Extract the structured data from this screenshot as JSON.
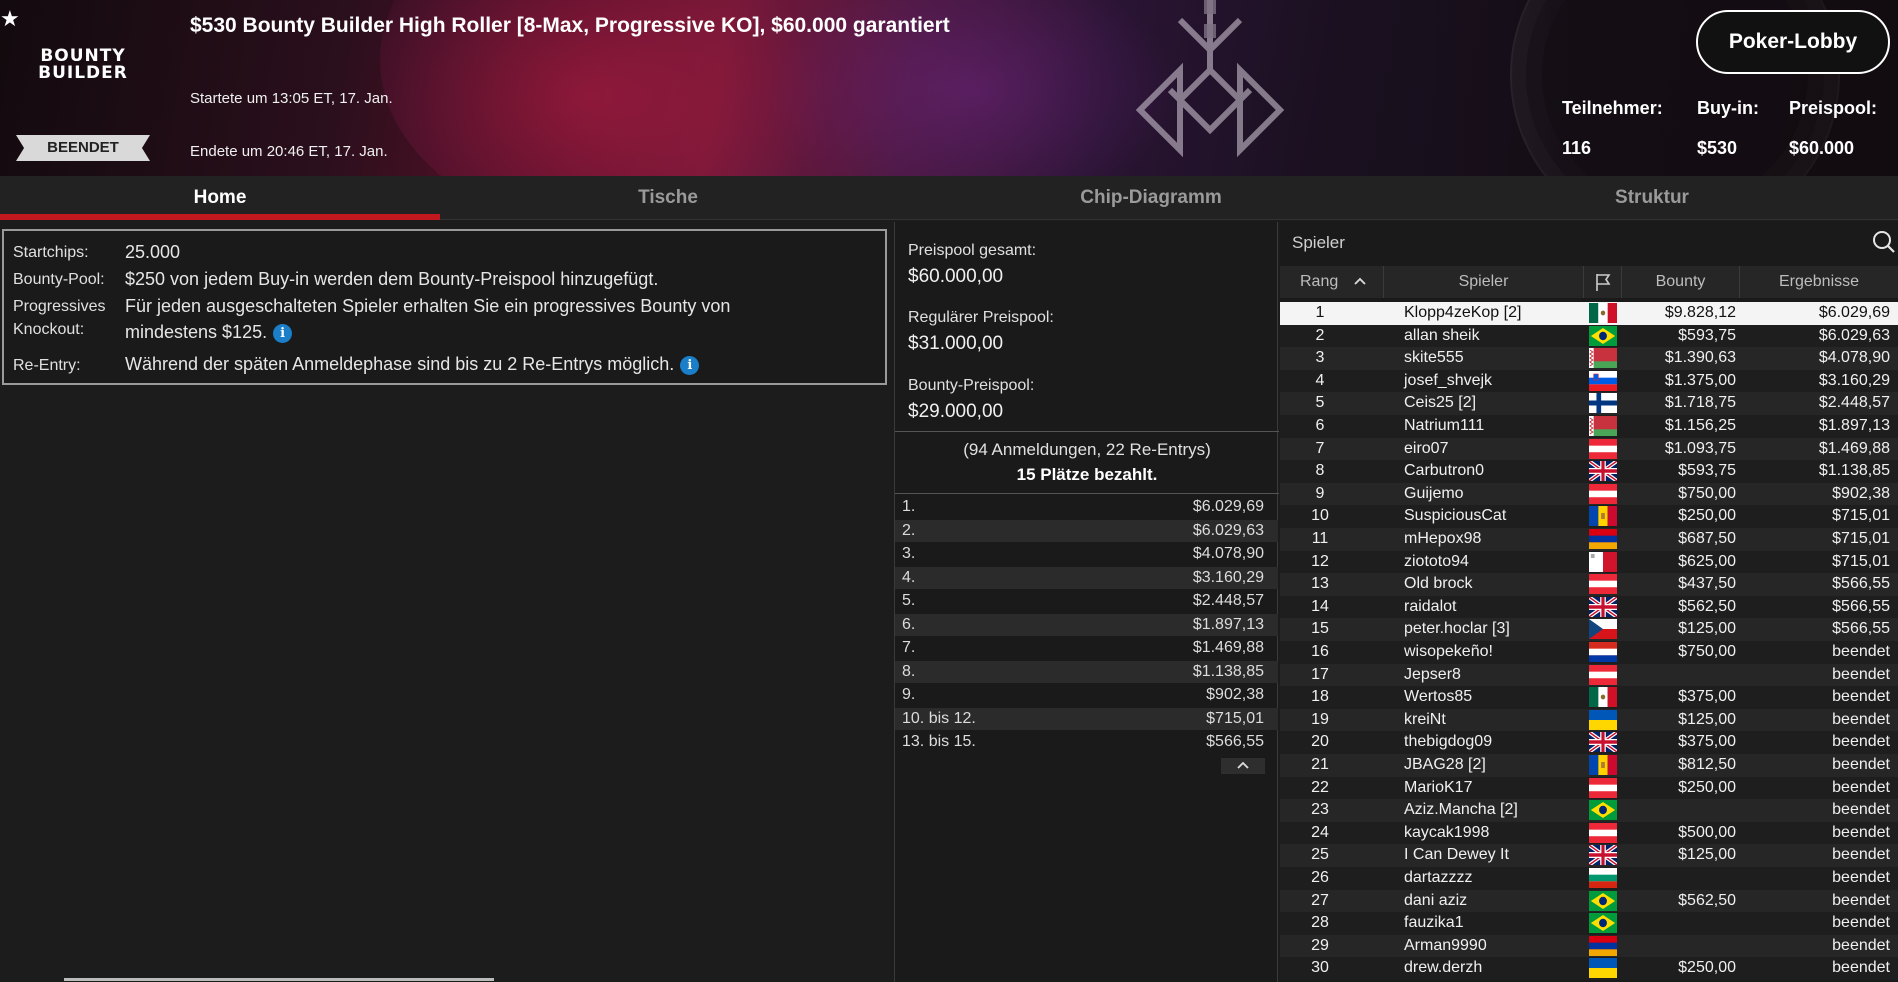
{
  "header": {
    "favorite_icon": "star-icon",
    "logo_line1": "BOUNTY",
    "logo_line2": "BUILDER",
    "status": "BEENDET",
    "title": "$530 Bounty Builder High Roller [8-Max, Progressive KO], $60.000 garantiert",
    "started": "Startete um 13:05 ET, 17. Jan.",
    "ended": "Endete um 20:46 ET, 17. Jan.",
    "lobby_button": "Poker-Lobby",
    "stats": {
      "participants_label": "Teilnehmer:",
      "participants_value": "116",
      "buyin_label": "Buy-in:",
      "buyin_value": "$530",
      "prizepool_label": "Preispool:",
      "prizepool_value": "$60.000"
    }
  },
  "tabs": [
    "Home",
    "Tische",
    "Chip-Diagramm",
    "Struktur"
  ],
  "info": {
    "startchips_label": "Startchips:",
    "startchips_value": "25.000",
    "bountypool_label": "Bounty-Pool:",
    "bountypool_value": "$250 von jedem Buy-in werden dem Bounty-Preispool hinzugefügt.",
    "pko_label_1": "Progressives",
    "pko_label_2": "Knockout:",
    "pko_value_1": "Für jeden ausgeschalteten Spieler erhalten Sie ein progressives Bounty von",
    "pko_value_2": "mindestens $125.",
    "reentry_label": "Re-Entry:",
    "reentry_value": "Während der späten Anmeldephase sind bis zu 2 Re-Entrys möglich.",
    "info_icon": "info-icon",
    "info_icon_glyph": "i"
  },
  "prizepool": {
    "total_label": "Preispool gesamt:",
    "total_value": "$60.000,00",
    "regular_label": "Regulärer Preispool:",
    "regular_value": "$31.000,00",
    "bounty_label": "Bounty-Preispool:",
    "bounty_value": "$29.000,00",
    "entries": "(94 Anmeldungen, 22 Re-Entrys)",
    "paid": "15 Plätze bezahlt.",
    "places": [
      {
        "place": "1.",
        "amount": "$6.029,69"
      },
      {
        "place": "2.",
        "amount": "$6.029,63"
      },
      {
        "place": "3.",
        "amount": "$4.078,90"
      },
      {
        "place": "4.",
        "amount": "$3.160,29"
      },
      {
        "place": "5.",
        "amount": "$2.448,57"
      },
      {
        "place": "6.",
        "amount": "$1.897,13"
      },
      {
        "place": "7.",
        "amount": "$1.469,88"
      },
      {
        "place": "8.",
        "amount": "$1.138,85"
      },
      {
        "place": "9.",
        "amount": "$902,38"
      },
      {
        "place": "10. bis 12.",
        "amount": "$715,01"
      },
      {
        "place": "13. bis 15.",
        "amount": "$566,55"
      }
    ],
    "collapse_icon": "chevron-up-icon",
    "collapse_glyph": "^"
  },
  "players": {
    "search_placeholder": "Spieler",
    "columns": {
      "rank": "Rang",
      "player": "Spieler",
      "bounty": "Bounty",
      "result": "Ergebnisse"
    },
    "sort_glyph": "^",
    "flag_column_icon": "flag-icon",
    "rows": [
      {
        "rank": "1",
        "name": "Klopp4zeKop [2]",
        "flag": "mx",
        "bounty": "$9.828,12",
        "result": "$6.029,69"
      },
      {
        "rank": "2",
        "name": "allan sheik",
        "flag": "br",
        "bounty": "$593,75",
        "result": "$6.029,63"
      },
      {
        "rank": "3",
        "name": "skite555",
        "flag": "by",
        "bounty": "$1.390,63",
        "result": "$4.078,90"
      },
      {
        "rank": "4",
        "name": "josef_shvejk",
        "flag": "si",
        "bounty": "$1.375,00",
        "result": "$3.160,29"
      },
      {
        "rank": "5",
        "name": "Ceis25 [2]",
        "flag": "fi",
        "bounty": "$1.718,75",
        "result": "$2.448,57"
      },
      {
        "rank": "6",
        "name": "Natrium111",
        "flag": "by",
        "bounty": "$1.156,25",
        "result": "$1.897,13"
      },
      {
        "rank": "7",
        "name": "eiro07",
        "flag": "at",
        "bounty": "$1.093,75",
        "result": "$1.469,88"
      },
      {
        "rank": "8",
        "name": "Carbutron0",
        "flag": "gb",
        "bounty": "$593,75",
        "result": "$1.138,85"
      },
      {
        "rank": "9",
        "name": "Guijemo",
        "flag": "at",
        "bounty": "$750,00",
        "result": "$902,38"
      },
      {
        "rank": "10",
        "name": "SuspiciousCat",
        "flag": "md",
        "bounty": "$250,00",
        "result": "$715,01"
      },
      {
        "rank": "11",
        "name": "mHepox98",
        "flag": "am",
        "bounty": "$687,50",
        "result": "$715,01"
      },
      {
        "rank": "12",
        "name": "ziototo94",
        "flag": "mt",
        "bounty": "$625,00",
        "result": "$715,01"
      },
      {
        "rank": "13",
        "name": "Old brock",
        "flag": "at",
        "bounty": "$437,50",
        "result": "$566,55"
      },
      {
        "rank": "14",
        "name": "raidalot",
        "flag": "gb",
        "bounty": "$562,50",
        "result": "$566,55"
      },
      {
        "rank": "15",
        "name": "peter.hoclar [3]",
        "flag": "cz",
        "bounty": "$125,00",
        "result": "$566,55"
      },
      {
        "rank": "16",
        "name": "wisopekeño!",
        "flag": "py",
        "bounty": "$750,00",
        "result": "beendet"
      },
      {
        "rank": "17",
        "name": "Jepser8",
        "flag": "at",
        "bounty": "",
        "result": "beendet"
      },
      {
        "rank": "18",
        "name": "Wertos85",
        "flag": "mx",
        "bounty": "$375,00",
        "result": "beendet"
      },
      {
        "rank": "19",
        "name": "kreiNt",
        "flag": "ua",
        "bounty": "$125,00",
        "result": "beendet"
      },
      {
        "rank": "20",
        "name": "thebigdog09",
        "flag": "gb",
        "bounty": "$375,00",
        "result": "beendet"
      },
      {
        "rank": "21",
        "name": "JBAG28 [2]",
        "flag": "md",
        "bounty": "$812,50",
        "result": "beendet"
      },
      {
        "rank": "22",
        "name": "MarioK17",
        "flag": "at",
        "bounty": "$250,00",
        "result": "beendet"
      },
      {
        "rank": "23",
        "name": "Aziz.Mancha [2]",
        "flag": "br",
        "bounty": "",
        "result": "beendet"
      },
      {
        "rank": "24",
        "name": "kaycak1998",
        "flag": "at",
        "bounty": "$500,00",
        "result": "beendet"
      },
      {
        "rank": "25",
        "name": "I Can Dewey It",
        "flag": "gb",
        "bounty": "$125,00",
        "result": "beendet"
      },
      {
        "rank": "26",
        "name": "dartazzzz",
        "flag": "bg",
        "bounty": "",
        "result": "beendet"
      },
      {
        "rank": "27",
        "name": "dani aziz",
        "flag": "br",
        "bounty": "$562,50",
        "result": "beendet"
      },
      {
        "rank": "28",
        "name": "fauzika1",
        "flag": "br",
        "bounty": "",
        "result": "beendet"
      },
      {
        "rank": "29",
        "name": "Arman9990",
        "flag": "am",
        "bounty": "",
        "result": "beendet"
      },
      {
        "rank": "30",
        "name": "drew.derzh",
        "flag": "ua",
        "bounty": "$250,00",
        "result": "beendet"
      }
    ]
  },
  "colors": {
    "accent": "#c0181e",
    "info_icon": "#1a7ec8"
  }
}
